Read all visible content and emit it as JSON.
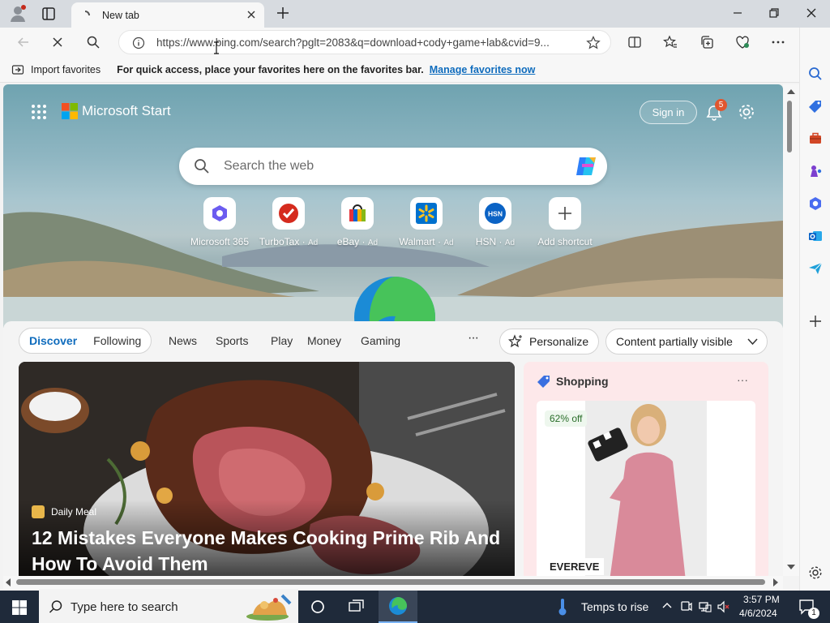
{
  "browser": {
    "tab_title": "New tab",
    "url": "https://www.bing.com/search?pglt=2083&q=download+cody+game+lab&cvid=9..."
  },
  "favorites_bar": {
    "import_label": "Import favorites",
    "message": "For quick access, place your favorites here on the favorites bar.",
    "manage_link": "Manage favorites now"
  },
  "start": {
    "brand": "Microsoft Start",
    "sign_in": "Sign in",
    "notification_count": "5",
    "search_placeholder": "Search the web",
    "shortcuts": [
      {
        "label": "Microsoft 365",
        "ad": ""
      },
      {
        "label": "TurboTax",
        "ad": "Ad"
      },
      {
        "label": "eBay",
        "ad": "Ad"
      },
      {
        "label": "Walmart",
        "ad": "Ad"
      },
      {
        "label": "HSN",
        "ad": "Ad"
      },
      {
        "label": "Add shortcut",
        "ad": ""
      }
    ]
  },
  "feed": {
    "tabs": [
      "Discover",
      "Following",
      "News",
      "Sports",
      "Play",
      "Money",
      "Gaming"
    ],
    "more": "···",
    "personalize": "Personalize",
    "content_visibility": "Content partially visible",
    "main_article": {
      "source": "Daily Meal",
      "title": "12 Mistakes Everyone Makes Cooking Prime Rib And How To Avoid Them"
    },
    "shopping": {
      "heading": "Shopping",
      "discount": "62% off",
      "brand": "EVEREVE"
    }
  },
  "taskbar": {
    "search_placeholder": "Type here to search",
    "weather": "Temps to rise",
    "time": "3:57 PM",
    "date": "4/6/2024",
    "notification_count": "1"
  }
}
